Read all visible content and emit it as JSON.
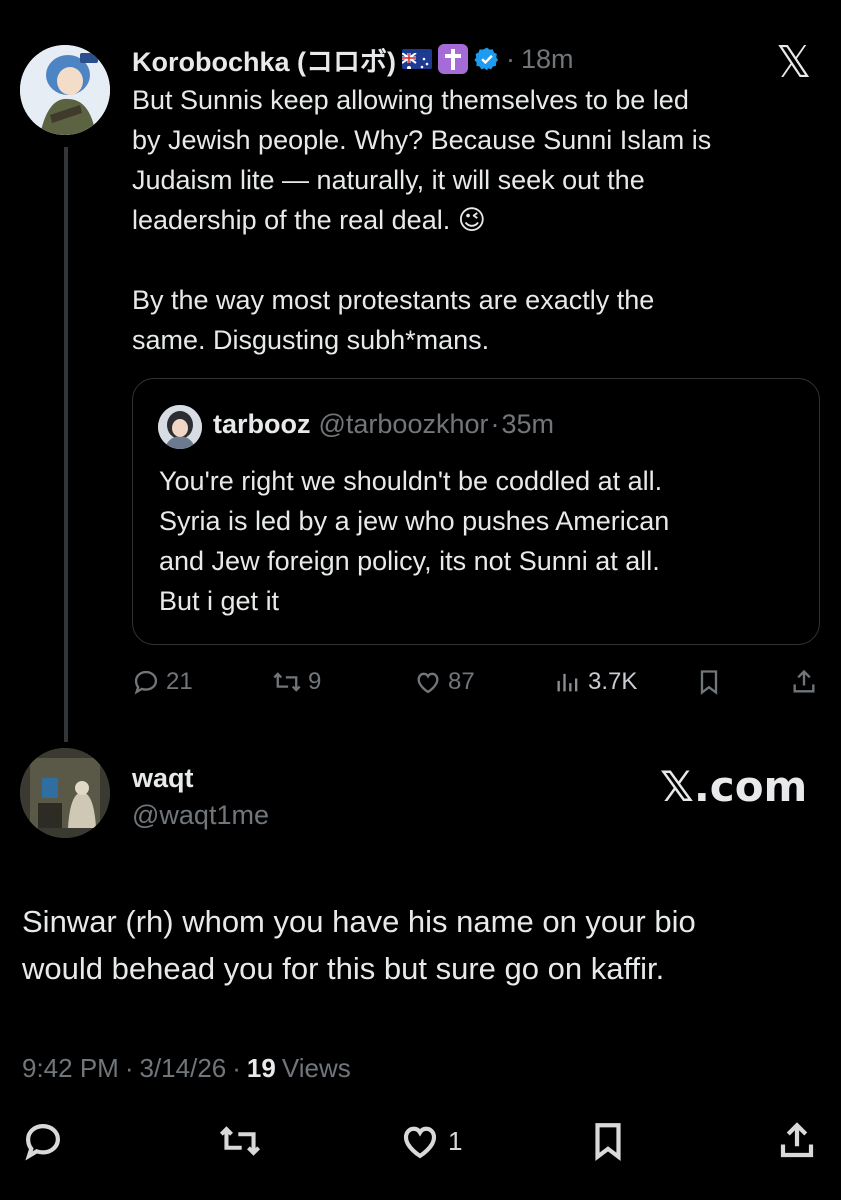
{
  "close_label": "𝕏",
  "watermark": "𝕏.com",
  "main_tweet": {
    "display_name": "Korobochka (コロボ)",
    "flag_emoji": "🇦🇺",
    "cross_emoji": "✝️",
    "time": "18m",
    "separator": "·",
    "text_lines": [
      "But Sunnis keep allowing themselves to be led",
      "by Jewish people. Why? Because Sunni Islam is",
      "Judaism lite — naturally, it will seek out the",
      "leadership of the real deal. 😉",
      "",
      "By the way most protestants are exactly the",
      "same. Disgusting subh*mans."
    ],
    "quote": {
      "display_name": "tarbooz",
      "handle": "@tarboozkhor",
      "time": "35m",
      "separator": "·",
      "text_lines": [
        "You're right we shouldn't be coddled at all.",
        "Syria is led by a jew who pushes American",
        "and Jew foreign policy, its not Sunni at all.",
        "But i get it"
      ]
    },
    "actions": {
      "replies": "21",
      "reposts": "9",
      "likes": "87",
      "views": "3.7K"
    }
  },
  "reply_tweet": {
    "display_name": "waqt",
    "handle": "@waqt1me",
    "text_lines": [
      "Sinwar (rh) whom you have his name on your bio",
      "would behead you for this but sure go on kaffir."
    ],
    "time": "9:42 PM",
    "date": "3/14/26",
    "separator": "·",
    "views_count": "19",
    "views_label": "Views",
    "likes": "1"
  }
}
